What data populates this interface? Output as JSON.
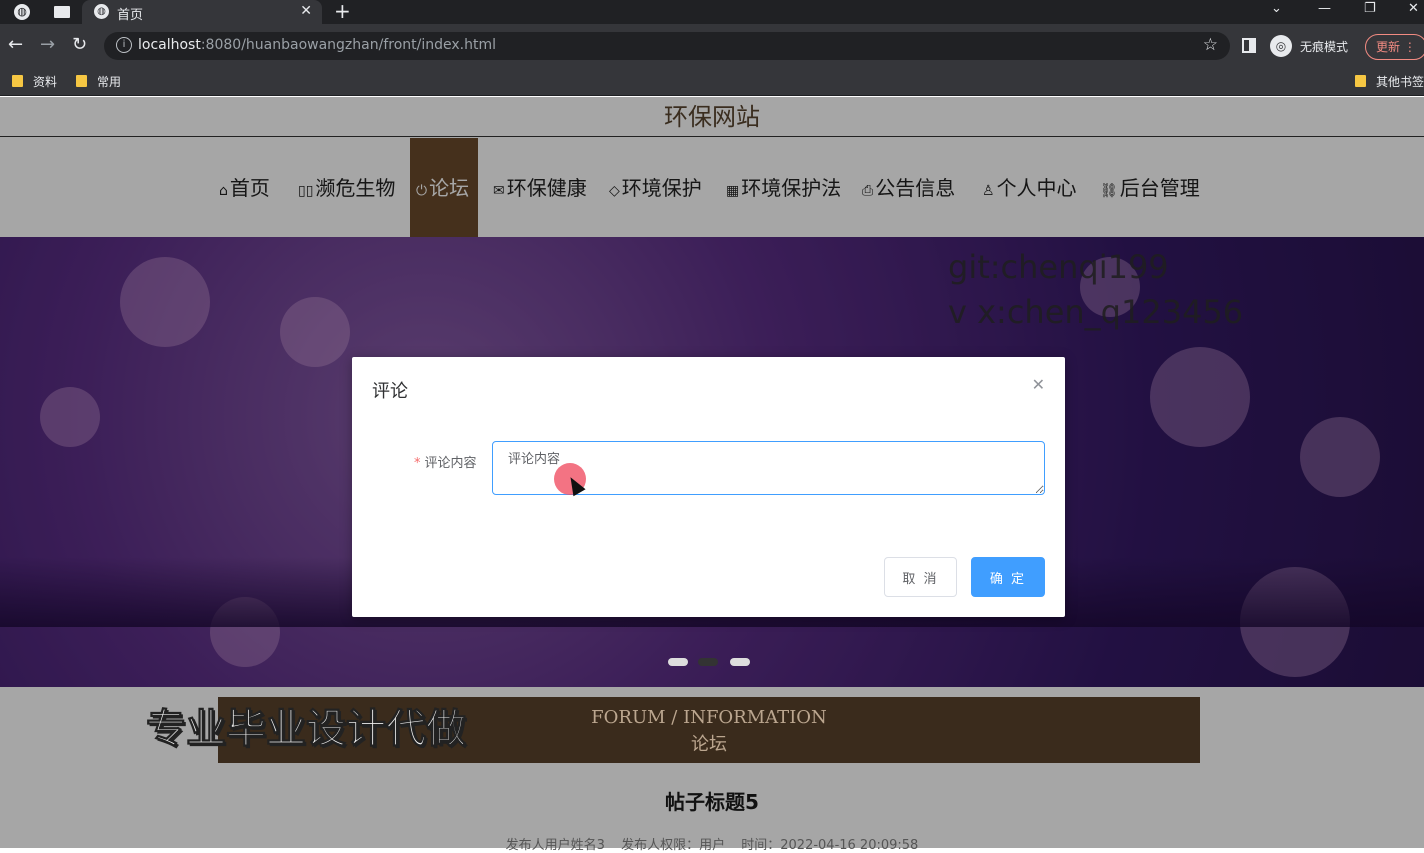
{
  "browser": {
    "tab_title": "首页",
    "url_host": "localhost",
    "url_path": ":8080/huanbaowangzhan/front/index.html",
    "incognito_label": "无痕模式",
    "update_label": "更新",
    "bookmarks": [
      "资料",
      "常用"
    ],
    "other_bookmarks": "其他书签"
  },
  "site": {
    "title": "环保网站",
    "nav": [
      {
        "label": "首页",
        "icon": "home-icon"
      },
      {
        "label": "濒危生物",
        "icon": "grid-icon"
      },
      {
        "label": "论坛",
        "icon": "power-icon"
      },
      {
        "label": "环保健康",
        "icon": "mail-icon"
      },
      {
        "label": "环境保护",
        "icon": "tag-icon"
      },
      {
        "label": "环境保护法",
        "icon": "apps-icon"
      },
      {
        "label": "公告信息",
        "icon": "printer-icon"
      },
      {
        "label": "个人中心",
        "icon": "user-icon"
      },
      {
        "label": "后台管理",
        "icon": "link-icon"
      }
    ],
    "active_nav": "论坛"
  },
  "overlay": {
    "watermark_line1": "git:chenqi199",
    "watermark_line2": "v x:chen_q123456",
    "promo": "专业毕业设计代做"
  },
  "forum": {
    "heading_en": "FORUM / INFORMATION",
    "heading_zh": "论坛",
    "post_title": "帖子标题5",
    "meta_author": "发布人用户姓名3",
    "meta_role": "发布人权限：用户",
    "meta_time": "时间：2022-04-16 20:09:58"
  },
  "dialog": {
    "title": "评论",
    "field_label": "评论内容",
    "field_value": "评论内容",
    "cancel_label": "取 消",
    "confirm_label": "确 定"
  },
  "colors": {
    "nav_active": "#6b4a2b",
    "primary": "#409eff"
  }
}
